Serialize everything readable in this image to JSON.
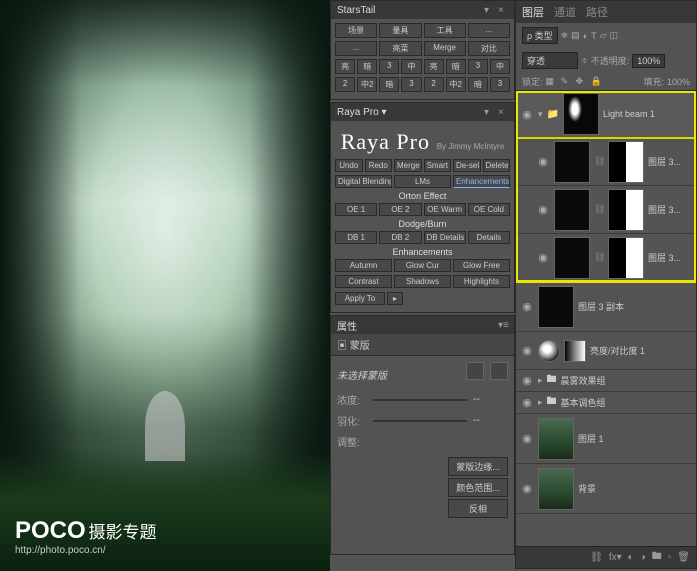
{
  "watermark": {
    "brand": "POCO",
    "subtitle": "摄影专题",
    "url": "http://photo.poco.cn/"
  },
  "starstail": {
    "title": "StarsTail",
    "tabs": [
      "场景",
      "量具",
      "工具",
      "..."
    ],
    "tabs2": [
      "...",
      "亮菜",
      "Merge",
      "对比"
    ],
    "rowA": [
      "亮",
      "暗",
      "3",
      "中",
      "亮",
      "暗",
      "3",
      "中"
    ],
    "rowB": [
      "2",
      "中2",
      "暗",
      "3",
      "2",
      "中2",
      "暗",
      "3"
    ]
  },
  "raya": {
    "title": "Raya Pro",
    "byline": "By Jimmy McIntyre",
    "row1": [
      "Undo",
      "Redo",
      "Merge",
      "Smart",
      "De-sel",
      "Delete"
    ],
    "row2": [
      "Digital Blending",
      "LMs",
      "Enhancements"
    ],
    "orton": {
      "label": "Orton Effect",
      "btns": [
        "OE 1",
        "OE 2",
        "OE Warm",
        "OE Cold"
      ]
    },
    "dodge": {
      "label": "Dodge/Burn",
      "btns": [
        "DB 1",
        "DB 2",
        "DB Details",
        "Details"
      ]
    },
    "enh": {
      "label": "Enhancements",
      "r1": [
        "Autumn",
        "Glow Cur",
        "Glow Free"
      ],
      "r2": [
        "Contrast",
        "Shadows",
        "Highlights"
      ]
    },
    "apply": "Apply To"
  },
  "properties": {
    "title": "属性",
    "mask_type": "蒙版",
    "group_mask": "未选择蒙版",
    "density": {
      "label": "浓度:",
      "value": "--"
    },
    "feather": {
      "label": "羽化:",
      "value": "--"
    },
    "refine": "调整:",
    "actions": [
      "蒙版边缘...",
      "颜色范围...",
      "反相"
    ]
  },
  "layers": {
    "tabs": [
      "图层",
      "通道",
      "路径"
    ],
    "kind": "ρ 类型",
    "blend": "穿透",
    "opacity_label": "不透明度:",
    "opacity": "100%",
    "lock_label": "锁定:",
    "fill_label": "填充:",
    "fill": "100%",
    "items": [
      {
        "name": "Light beam 1"
      },
      {
        "name": "图层 3..."
      },
      {
        "name": "图层 3..."
      },
      {
        "name": "图层 3..."
      },
      {
        "name": "图层 3 副本"
      },
      {
        "name": "亮度/对比度 1"
      },
      {
        "name": "晨雾效果组"
      },
      {
        "name": "基本调色组"
      },
      {
        "name": "图层 1"
      },
      {
        "name": "背景"
      }
    ]
  }
}
